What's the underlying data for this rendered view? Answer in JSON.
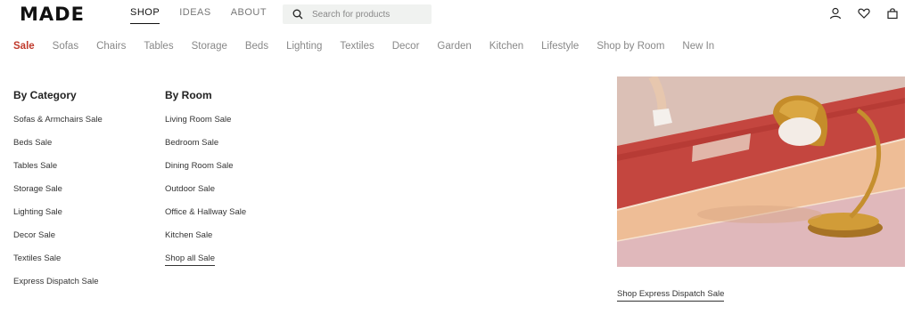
{
  "header": {
    "logo": "MADE",
    "nav": [
      {
        "label": "SHOP",
        "active": true
      },
      {
        "label": "IDEAS",
        "active": false
      },
      {
        "label": "ABOUT",
        "active": false
      }
    ],
    "search": {
      "placeholder": "Search for products",
      "value": ""
    },
    "icons": [
      "account-icon",
      "wishlist-heart-icon",
      "basket-icon"
    ]
  },
  "category_nav": {
    "items": [
      "Sale",
      "Sofas",
      "Chairs",
      "Tables",
      "Storage",
      "Beds",
      "Lighting",
      "Textiles",
      "Decor",
      "Garden",
      "Kitchen",
      "Lifestyle",
      "Shop by Room",
      "New In"
    ],
    "active_color": "#c0392b"
  },
  "menu": {
    "by_category": {
      "heading": "By Category",
      "links": [
        "Sofas & Armchairs Sale",
        "Beds Sale",
        "Tables Sale",
        "Storage Sale",
        "Lighting Sale",
        "Decor Sale",
        "Textiles Sale",
        "Express Dispatch Sale"
      ]
    },
    "by_room": {
      "heading": "By Room",
      "links": [
        "Living Room Sale",
        "Bedroom Sale",
        "Dining Room Sale",
        "Outdoor Sale",
        "Office & Hallway Sale",
        "Kitchen Sale",
        "Shop all Sale"
      ]
    }
  },
  "promo": {
    "image": "brass-desk-lamp-on-running-track-image",
    "link": "Shop Express Dispatch Sale"
  }
}
